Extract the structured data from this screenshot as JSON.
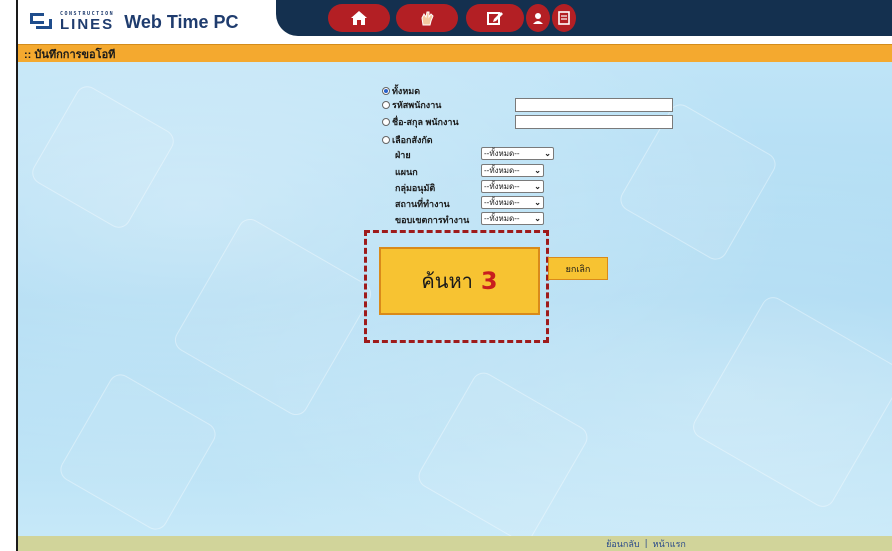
{
  "header": {
    "logo_small": "CONSTRUCTION",
    "logo_big": "LINES",
    "app_name": "Web Time PC",
    "nav": [
      {
        "icon": "home-icon"
      },
      {
        "icon": "hand-icon"
      },
      {
        "icon": "edit-icon"
      },
      {
        "icon": "user-icon"
      },
      {
        "icon": "document-icon"
      }
    ]
  },
  "title_bar": {
    "text": ":: บันทึกการขอโอที"
  },
  "form": {
    "radio_all": "ทั้งหมด",
    "radio_emp_code": "รหัสพนักงาน",
    "radio_emp_name": "ชื่อ-สกุล พนักงาน",
    "radio_affiliation": "เลือกสังกัด",
    "emp_code_value": "",
    "emp_name_value": "",
    "fields": [
      {
        "label": "ฝ่าย",
        "value": "--ทั้งหมด--"
      },
      {
        "label": "แผนก",
        "value": "--ทั้งหมด--"
      },
      {
        "label": "กลุ่มอนุมัติ",
        "value": "--ทั้งหมด--"
      },
      {
        "label": "สถานที่ทำงาน",
        "value": "--ทั้งหมด--"
      },
      {
        "label": "ขอบเขตการทำงาน",
        "value": "--ทั้งหมด--"
      }
    ],
    "search_label": "ค้นหา",
    "step_marker": "3",
    "cancel_label": "ยกเลิก"
  },
  "footer": {
    "back": "ย้อนกลับ",
    "separator": "|",
    "home": "หน้าแรก"
  },
  "colors": {
    "header_dark": "#14304f",
    "nav_red": "#b31f24",
    "title_orange": "#f4a92f",
    "button_yellow": "#f7c332",
    "highlight_red": "#9e1b1b",
    "footer_olive": "#d1d49a"
  }
}
